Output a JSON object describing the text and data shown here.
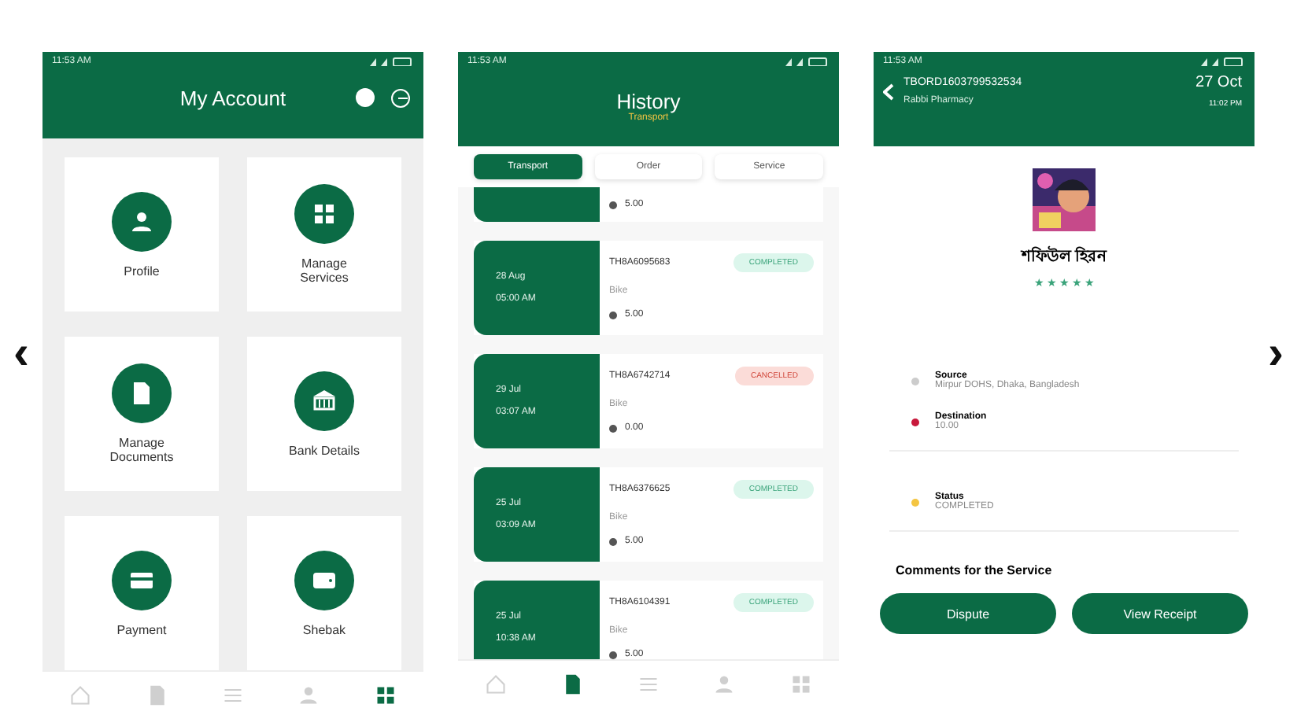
{
  "nav_arrows": {
    "prev": "‹",
    "next": "›"
  },
  "screens": [
    {
      "kind": "account",
      "status_time": "11:53 AM",
      "title": "My Account",
      "tiles": [
        {
          "label": "Profile"
        },
        {
          "label": "Manage Services"
        },
        {
          "label": "Manage Documents"
        },
        {
          "label": "Bank Details"
        },
        {
          "label": "Payment"
        },
        {
          "label": "Shebak"
        }
      ],
      "nav": [
        {
          "selected": false
        },
        {
          "selected": false
        },
        {
          "selected": false
        },
        {
          "selected": false
        },
        {
          "selected": true
        }
      ]
    },
    {
      "kind": "history",
      "status_time": "11:53 AM",
      "title": "History",
      "subtitle": "Transport",
      "tabs": [
        {
          "label": "Transport",
          "selected": true
        },
        {
          "label": "Order",
          "selected": false
        },
        {
          "label": "Service",
          "selected": false
        }
      ],
      "partial_rating": "5.00",
      "trips": [
        {
          "date": "28 Aug",
          "time": "05:00 AM",
          "id": "TH8A6095683",
          "vehicle": "Bike",
          "rating": "5.00",
          "status": "COMPLETED",
          "cancelled": false
        },
        {
          "date": "29 Jul",
          "time": "03:07 AM",
          "id": "TH8A6742714",
          "vehicle": "Bike",
          "rating": "0.00",
          "status": "CANCELLED",
          "cancelled": true
        },
        {
          "date": "25 Jul",
          "time": "03:09 AM",
          "id": "TH8A6376625",
          "vehicle": "Bike",
          "rating": "5.00",
          "status": "COMPLETED",
          "cancelled": false
        },
        {
          "date": "25 Jul",
          "time": "10:38 AM",
          "id": "TH8A6104391",
          "vehicle": "Bike",
          "rating": "5.00",
          "status": "COMPLETED",
          "cancelled": false
        }
      ],
      "nav": [
        {
          "selected": false
        },
        {
          "selected": true
        },
        {
          "selected": false
        },
        {
          "selected": false
        },
        {
          "selected": false
        }
      ]
    },
    {
      "kind": "detail",
      "status_time": "11:53 AM",
      "order_id": "TBORD1603799532534",
      "shop": "Rabbi Pharmacy",
      "date": "27 Oct",
      "time": "11:02 PM",
      "name": "শফিউল হিরন",
      "stars": 5,
      "source_label": "Source",
      "source": "Mirpur DOHS, Dhaka, Bangladesh",
      "destination_label": "Destination",
      "destination": "10.00",
      "status_label": "Status",
      "status": "COMPLETED",
      "comments": "Comments for the Service",
      "buttons": [
        "Dispute",
        "View Receipt"
      ]
    }
  ]
}
